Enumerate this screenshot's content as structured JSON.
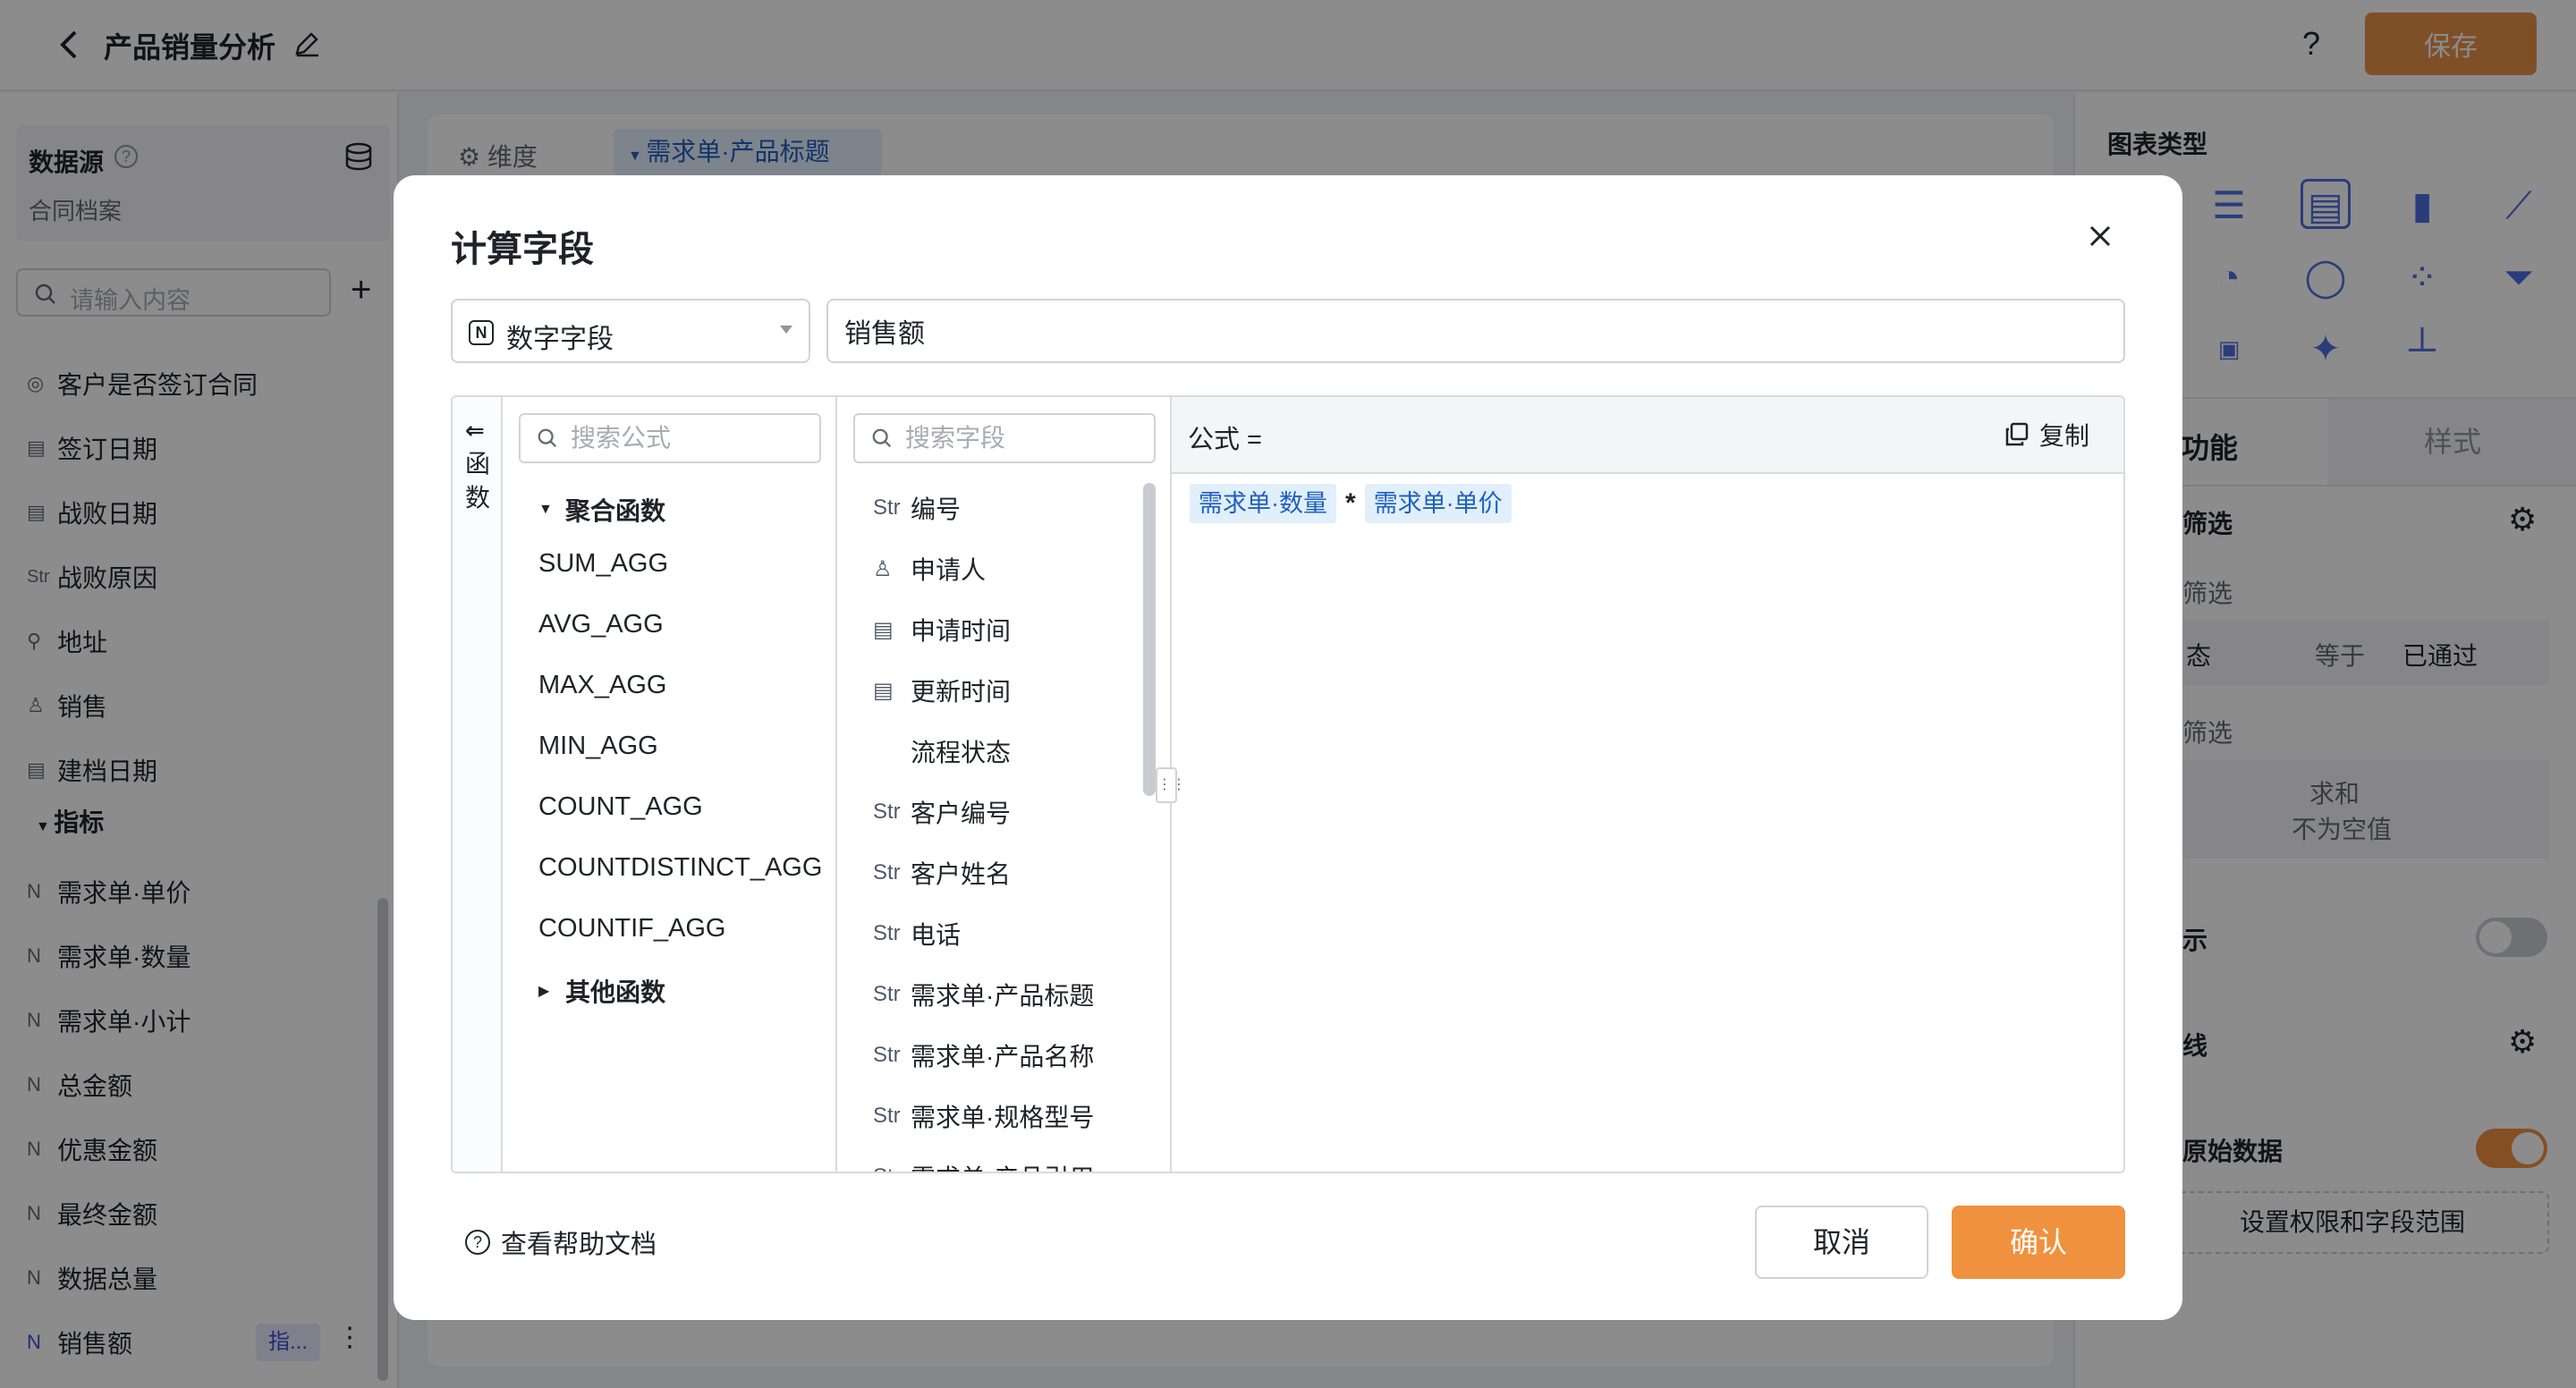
{
  "app": {
    "title": "产品销量分析",
    "save_label": "保存",
    "help_label": "?"
  },
  "colors": {
    "accent": "#F0913F",
    "token_bg": "#E0EFFA",
    "token_text": "#1F5FBF"
  },
  "left_panel": {
    "datasource_label": "数据源",
    "datasource_name": "合同档案",
    "search_placeholder": "请输入内容",
    "fields": [
      {
        "icon": "target-icon",
        "glyph": "◎",
        "label": "客户是否签订合同"
      },
      {
        "icon": "calendar-icon",
        "glyph": "▤",
        "label": "签订日期"
      },
      {
        "icon": "calendar-icon",
        "glyph": "▤",
        "label": "战败日期"
      },
      {
        "icon": "string-icon",
        "glyph": "Str",
        "label": "战败原因"
      },
      {
        "icon": "location-icon",
        "glyph": "⚲",
        "label": "地址"
      },
      {
        "icon": "person-icon",
        "glyph": "♙",
        "label": "销售"
      },
      {
        "icon": "calendar-icon",
        "glyph": "▤",
        "label": "建档日期"
      }
    ],
    "metrics_group": "指标",
    "metrics": [
      {
        "icon": "number-icon",
        "glyph": "N",
        "label": "需求单·单价"
      },
      {
        "icon": "number-icon",
        "glyph": "N",
        "label": "需求单·数量"
      },
      {
        "icon": "number-icon",
        "glyph": "N",
        "label": "需求单·小计"
      },
      {
        "icon": "number-icon",
        "glyph": "N",
        "label": "总金额"
      },
      {
        "icon": "number-icon",
        "glyph": "N",
        "label": "优惠金额"
      },
      {
        "icon": "number-icon",
        "glyph": "N",
        "label": "最终金额"
      },
      {
        "icon": "number-icon",
        "glyph": "N",
        "label": "数据总量"
      },
      {
        "icon": "number-icon",
        "glyph": "N",
        "label": "销售额"
      }
    ],
    "metric_tag": "指..."
  },
  "center": {
    "dimension_label": "维度",
    "dimension_tag": "需求单·产品标题"
  },
  "right_panel": {
    "chart_type_label": "图表类型",
    "tab_function": "功能",
    "tab_style": "样式",
    "filter_label": "筛选",
    "filter_sub1": "筛选",
    "filter_cond_field": "态",
    "filter_cond_op": "等于",
    "filter_cond_value": "已通过",
    "filter_sub2": "筛选",
    "filter2_agg": "求和",
    "filter2_cond": "不为空值",
    "show_label": "示",
    "line_label": "线",
    "raw_data_label": "原始数据",
    "perm_button": "设置权限和字段范围"
  },
  "modal": {
    "title": "计算字段",
    "type_select": "数字字段",
    "field_name": "销售额",
    "rail_label": "函数",
    "fn_search_placeholder": "搜索公式",
    "fn_group_agg": "聚合函数",
    "functions": [
      "SUM_AGG",
      "AVG_AGG",
      "MAX_AGG",
      "MIN_AGG",
      "COUNT_AGG",
      "COUNTDISTINCT_AGG",
      "COUNTIF_AGG"
    ],
    "fn_group_other": "其他函数",
    "field_search_placeholder": "搜索字段",
    "fields": [
      {
        "icon": "string-icon",
        "glyph": "Str",
        "label": "编号"
      },
      {
        "icon": "person-icon",
        "glyph": "♙",
        "label": "申请人"
      },
      {
        "icon": "calendar-icon",
        "glyph": "▤",
        "label": "申请时间"
      },
      {
        "icon": "calendar-icon",
        "glyph": "▤",
        "label": "更新时间"
      },
      {
        "icon": "none",
        "glyph": "",
        "label": "流程状态"
      },
      {
        "icon": "string-icon",
        "glyph": "Str",
        "label": "客户编号"
      },
      {
        "icon": "string-icon",
        "glyph": "Str",
        "label": "客户姓名"
      },
      {
        "icon": "string-icon",
        "glyph": "Str",
        "label": "电话"
      },
      {
        "icon": "string-icon",
        "glyph": "Str",
        "label": "需求单·产品标题"
      },
      {
        "icon": "string-icon",
        "glyph": "Str",
        "label": "需求单·产品名称"
      },
      {
        "icon": "string-icon",
        "glyph": "Str",
        "label": "需求单·规格型号"
      },
      {
        "icon": "string-icon",
        "glyph": "Str",
        "label": "需求单·产品引用"
      }
    ],
    "formula_label": "公式 =",
    "copy_label": "复制",
    "formula_tokens": [
      "需求单·数量",
      "*",
      "需求单·单价"
    ],
    "help_link": "查看帮助文档",
    "cancel": "取消",
    "confirm": "确认"
  }
}
